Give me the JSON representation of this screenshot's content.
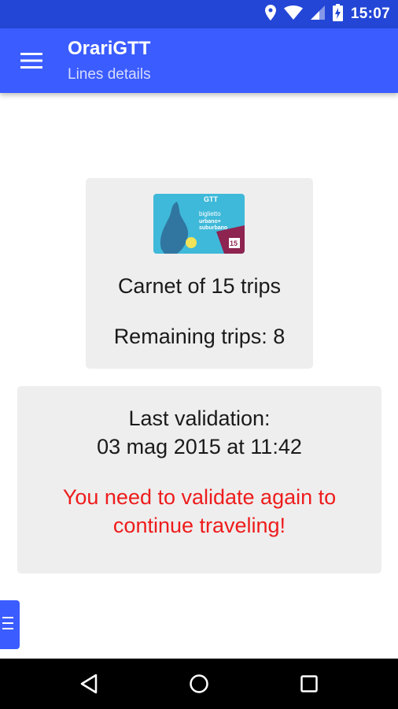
{
  "status_bar": {
    "time": "15:07",
    "icons": [
      "location-icon",
      "wifi-icon",
      "cell-signal-icon",
      "battery-charging-icon"
    ]
  },
  "app_bar": {
    "title": "OrariGTT",
    "subtitle": "Lines details",
    "menu_icon": "hamburger-menu-icon"
  },
  "ticket": {
    "carnet_label": "Carnet of 15 trips",
    "remaining_label": "Remaining trips: 8",
    "image_text": {
      "brand": "GTT",
      "line1": "biglietto",
      "line2": "urbano+",
      "line3": "suburbano",
      "trips": "15"
    }
  },
  "validation": {
    "label": "Last validation:",
    "date": "03 mag 2015 at 11:42",
    "warning_line1": "You need to validate again to",
    "warning_line2": "continue traveling!"
  },
  "colors": {
    "status_bar": "#2346d6",
    "app_bar": "#3b5cff",
    "card_bg": "#eeeeee",
    "warning": "#ee1c1c"
  },
  "nav_bar": {
    "icons": [
      "back-icon",
      "home-icon",
      "recents-icon"
    ]
  }
}
